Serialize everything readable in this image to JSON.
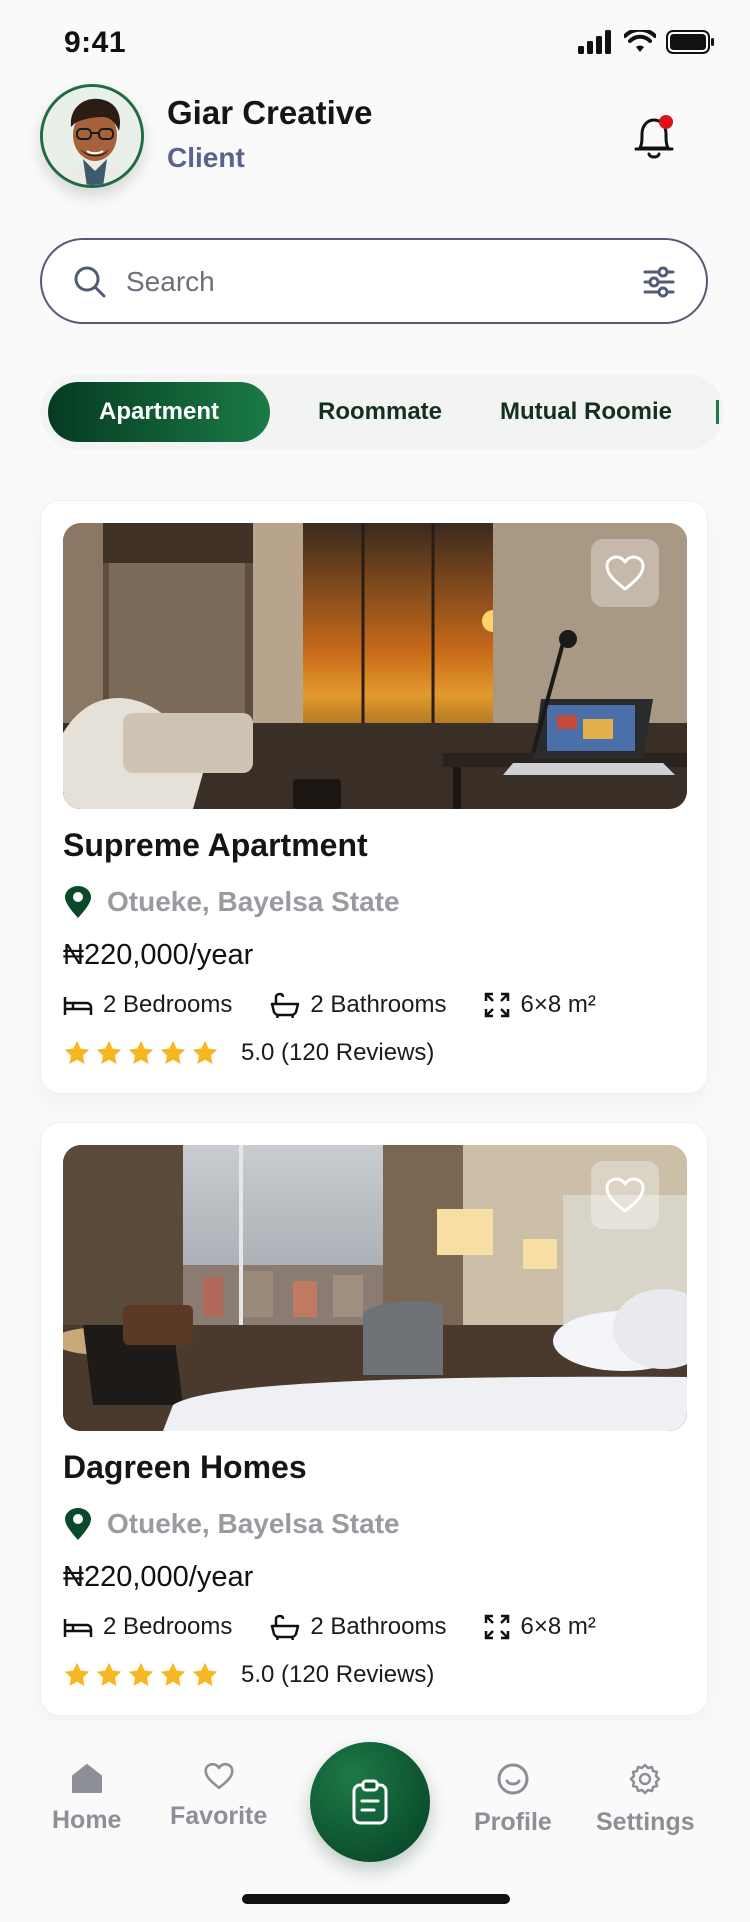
{
  "status_bar": {
    "time": "9:41"
  },
  "header": {
    "user_name": "Giar Creative",
    "user_role": "Client"
  },
  "search": {
    "placeholder": "Search"
  },
  "tabs": [
    {
      "label": "Apartment",
      "active": true
    },
    {
      "label": "Roommate",
      "active": false
    },
    {
      "label": "Mutual Roomie",
      "active": false
    }
  ],
  "listings": [
    {
      "title": "Supreme Apartment",
      "location": "Otueke, Bayelsa State",
      "price": "₦220,000/year",
      "bedrooms": "2 Bedrooms",
      "bathrooms": "2 Bathrooms",
      "size": "6×8 m²",
      "rating": 5.0,
      "rating_text": "5.0 (120 Reviews)"
    },
    {
      "title": "Dagreen Homes",
      "location": "Otueke, Bayelsa State",
      "price": "₦220,000/year",
      "bedrooms": "2 Bedrooms",
      "bathrooms": "2 Bathrooms",
      "size": "6×8 m²",
      "rating": 5.0,
      "rating_text": "5.0 (120 Reviews)"
    }
  ],
  "bottom_nav": {
    "home": "Home",
    "favorite": "Favorite",
    "profile": "Profile",
    "settings": "Settings"
  },
  "colors": {
    "brand_dark": "#063b22",
    "brand_light": "#1a7a45",
    "star": "#f5b820",
    "notification_dot": "#e0101b",
    "role_text": "#5b6290"
  }
}
